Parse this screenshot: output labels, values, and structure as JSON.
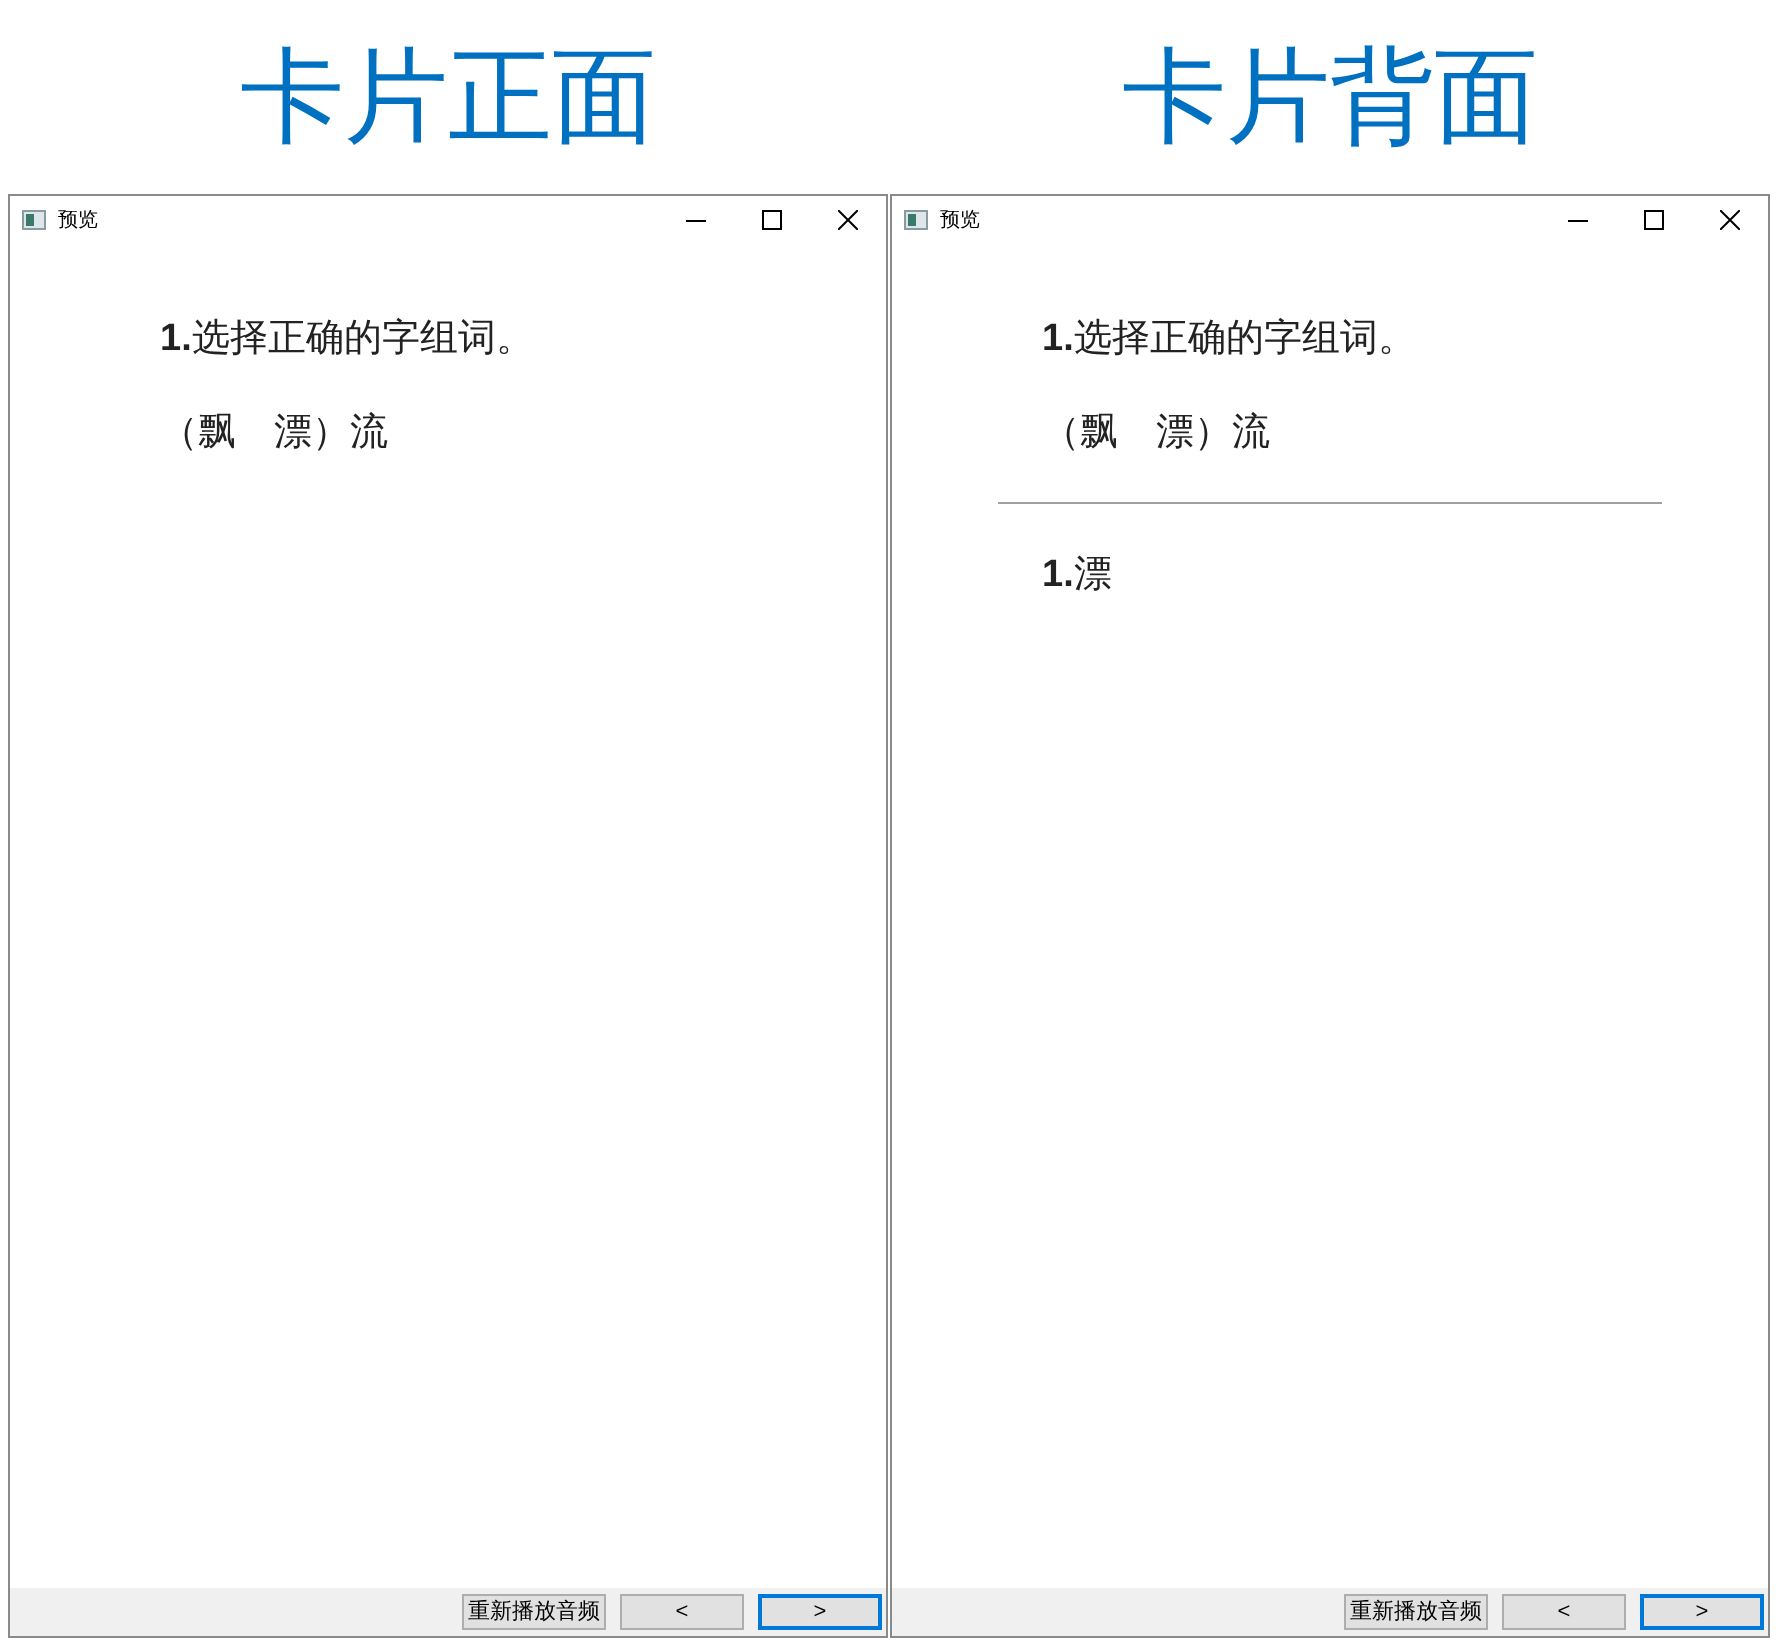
{
  "panels": [
    {
      "heading": "卡片正面",
      "window": {
        "title": "预览"
      },
      "question": "**1.**选择正确的字组词。",
      "choices": "（飘　漂）流",
      "buttons": [
        {
          "label": "重新播放音频",
          "kind": "replay",
          "focused": false
        },
        {
          "label": "<",
          "kind": "nav",
          "focused": false
        },
        {
          "label": ">",
          "kind": "nav",
          "focused": true
        }
      ]
    },
    {
      "heading": "卡片背面",
      "window": {
        "title": "预览"
      },
      "question": "**1.**选择正确的字组词。",
      "choices": "（飘　漂）流",
      "answer": "**1.**漂",
      "buttons": [
        {
          "label": "重新播放音频",
          "kind": "replay",
          "focused": false
        },
        {
          "label": "<",
          "kind": "nav",
          "focused": false
        },
        {
          "label": ">",
          "kind": "nav",
          "focused": true
        }
      ]
    }
  ]
}
